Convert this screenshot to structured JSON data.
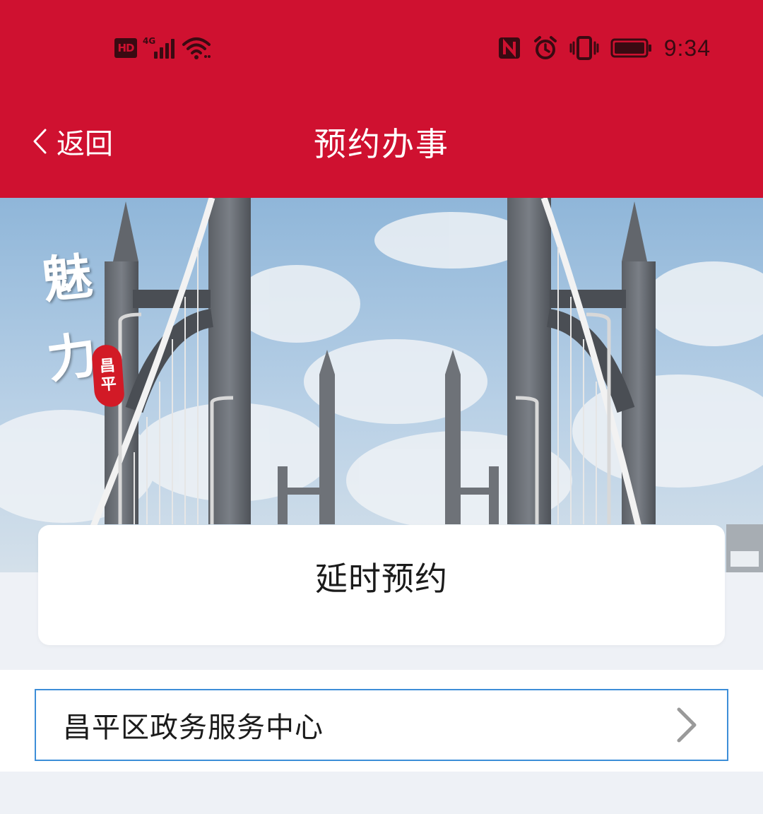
{
  "status_bar": {
    "network_badge": "HD",
    "network_type": "4G",
    "time": "9:34",
    "icons": [
      "hd-icon",
      "signal-icon",
      "wifi-icon",
      "nfc-icon",
      "alarm-icon",
      "vibrate-icon",
      "battery-icon"
    ]
  },
  "nav": {
    "back_label": "返回",
    "title": "预约办事"
  },
  "banner": {
    "calligraphy": [
      "魅",
      "力"
    ],
    "seal_text": [
      "昌",
      "平"
    ]
  },
  "card": {
    "title": "延时预约"
  },
  "list": {
    "items": [
      {
        "label": "昌平区政务服务中心"
      }
    ]
  },
  "colors": {
    "header_red": "#cf1130",
    "page_bg": "#eef1f6",
    "highlight_border": "#3d8ed8"
  }
}
